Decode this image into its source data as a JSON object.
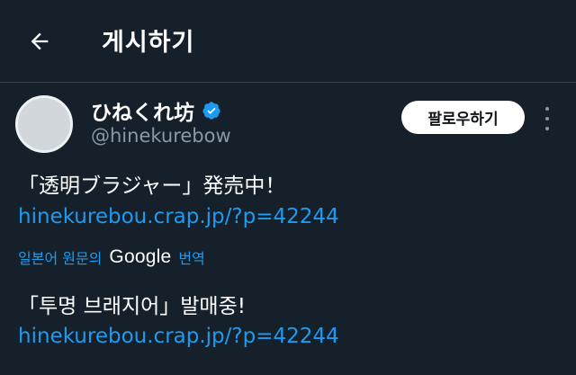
{
  "header": {
    "title": "게시하기",
    "back_icon": "arrow-left-icon"
  },
  "author": {
    "display_name": "ひねくれ坊",
    "handle": "@hinekurebow",
    "verified_icon": "verified-badge-icon",
    "verified_color": "#1d9bf0"
  },
  "actions": {
    "follow_label": "팔로우하기",
    "more_icon": "more-vertical-icon"
  },
  "post": {
    "original_text": "「透明ブラジャー」発売中！",
    "original_link": "hinekurebou.crap.jp/?p=42244",
    "translate_prefix": "일본어 원문의",
    "translate_provider": "Google",
    "translate_suffix": "번역",
    "translated_text": "「투명 브래지어」발매중!",
    "translated_link": "hinekurebou.crap.jp/?p=42244"
  },
  "colors": {
    "background": "#15202b",
    "link": "#1d9bf0",
    "secondary_text": "#8b98a5",
    "divider": "#38444d"
  }
}
